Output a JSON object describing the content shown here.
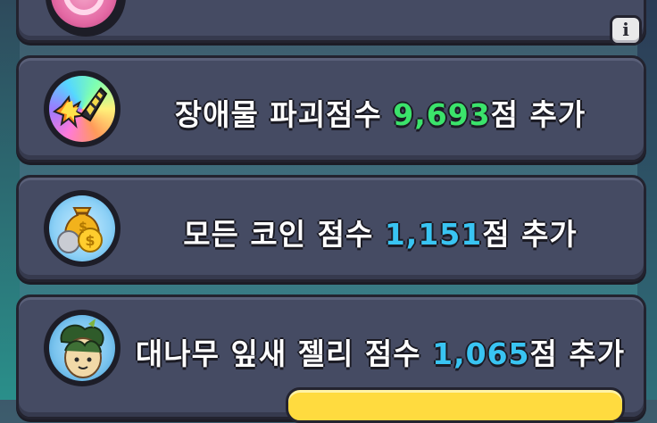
{
  "info_button": {
    "label": "i"
  },
  "bonuses": [
    {
      "icon": "pink-orb-icon",
      "text_before": "",
      "value": "",
      "text_after": ""
    },
    {
      "icon": "obstacle-smash-icon",
      "text_before": "장애물 파괴점수 ",
      "value": "9,693",
      "text_after": "점 추가",
      "value_color": "#3be36b"
    },
    {
      "icon": "coin-bag-icon",
      "text_before": "모든 코인 점수 ",
      "value": "1,151",
      "text_after": "점 추가",
      "value_color": "#39c4f2"
    },
    {
      "icon": "bamboo-leaf-cookie-icon",
      "text_before": "대나무 잎새 젤리 점수 ",
      "value": "1,065",
      "text_after": "점 추가",
      "value_color": "#39c4f2"
    }
  ]
}
